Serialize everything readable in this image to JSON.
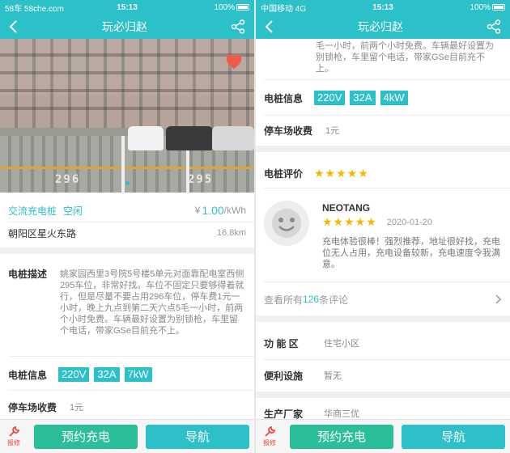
{
  "left": {
    "status": {
      "carrier": "58车 58che.com",
      "time": "15:13",
      "battery": "100%"
    },
    "title": "玩必归赵",
    "photo": {
      "paint_number": "296",
      "paint_number2": "295"
    },
    "charger": {
      "type": "交流充电桩",
      "status": "空闲",
      "price_symbol": "¥",
      "price": "1.00",
      "price_unit": "/kWh"
    },
    "location": {
      "address": "朝阳区星火东路",
      "distance": "16.8km"
    },
    "description": {
      "label": "电桩描述",
      "text": "姚家园西里3号院5号楼5单元对面靠配电室西侧295车位，非常好找。车位不固定只要够得着就行，但是尽量不要占用296车位，停车费1元一小时，晚上九点到第二天六点5毛一小时，前两个小时免费。车辆最好设置为别锁枪，车里留个电话，带家GSe目前充不上。"
    },
    "info": {
      "label": "电桩信息",
      "tags": [
        "220V",
        "32A",
        "7kW"
      ]
    },
    "parking": {
      "label": "停车场收费",
      "value": "1元"
    },
    "bottom": {
      "report": "报修",
      "book": "预约充电",
      "navigate": "导航"
    }
  },
  "right": {
    "status": {
      "carrier": "中国移动 4G",
      "time": "15:13",
      "battery": "100%"
    },
    "title": "玩必归赵",
    "desc_tail": "毛一小时，前两个小时免费。车辆最好设置为别锁枪，车里留个电话，带家GSe目前充不上。",
    "info": {
      "label": "电桩信息",
      "tags": [
        "220V",
        "32A",
        "4kW"
      ]
    },
    "parking": {
      "label": "停车场收费",
      "value": "1元"
    },
    "rating": {
      "label": "电桩评价",
      "stars": "★★★★★"
    },
    "review": {
      "user": "NEOTANG",
      "stars": "★★★★★",
      "date": "2020-01-20",
      "text": "充电体验很棒！强烈推荐，地址很好找，充电位无人占用，充电设备较新，充电速度令我满意。"
    },
    "all_reviews": {
      "prefix": "查看所有",
      "count": "126",
      "suffix": "条评论"
    },
    "function": {
      "label": "功 能 区",
      "value": "住宅小区"
    },
    "facilities": {
      "label": "便利设施",
      "value": "暂无"
    },
    "manufacturer": {
      "label": "生产厂家",
      "value": "华商三优"
    },
    "bottom": {
      "report": "报修",
      "book": "预约充电",
      "navigate": "导航"
    }
  },
  "colors": {
    "accent": "#2cc0c9",
    "book_button": "#2abf9a",
    "star": "#f5b800",
    "heart": "#f05a4a",
    "report": "#e94a3c"
  }
}
